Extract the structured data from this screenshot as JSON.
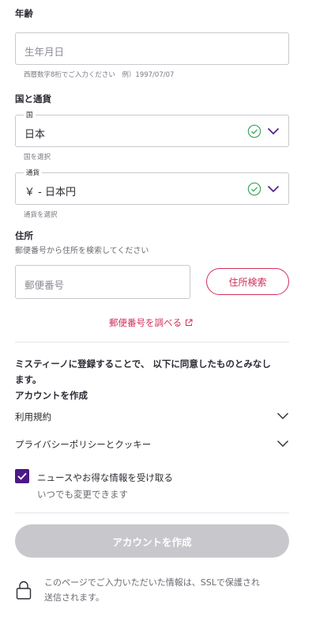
{
  "age": {
    "label": "年齢",
    "placeholder": "生年月日",
    "helper": "西暦数字8桁でご入力ください　例）1997/07/07"
  },
  "country_currency": {
    "label": "国と通貨",
    "country": {
      "float_label": "国",
      "value": "日本",
      "helper": "国を選択"
    },
    "currency": {
      "float_label": "通貨",
      "value": "￥ - 日本円",
      "helper": "通貨を選択"
    }
  },
  "address": {
    "label": "住所",
    "sub": "郵便番号から住所を検索してください",
    "postal_placeholder": "郵便番号",
    "search_button": "住所検索",
    "lookup_link": "郵便番号を調べる"
  },
  "legal": {
    "line1": "ミスティーノに登録することで、 以下に同意したものとみなし",
    "line2": "ます。",
    "line3": "アカウントを作成"
  },
  "accordions": [
    {
      "label": "利用規約"
    },
    {
      "label": "プライバシーポリシーとクッキー"
    }
  ],
  "newsletter": {
    "label": "ニュースやお得な情報を受け取る",
    "sub": "いつでも変更できます",
    "checked": true
  },
  "submit": {
    "label": "アカウントを作成"
  },
  "ssl": {
    "line1": "このページでご入力いただいた情報は、SSLで保護され",
    "line2": "送信されます。"
  },
  "colors": {
    "accent": "#d0305a",
    "checkbox": "#4b1a86",
    "valid": "#3aa35a",
    "chevron": "#4b1a86",
    "disabled_button": "#c8c8cc"
  }
}
